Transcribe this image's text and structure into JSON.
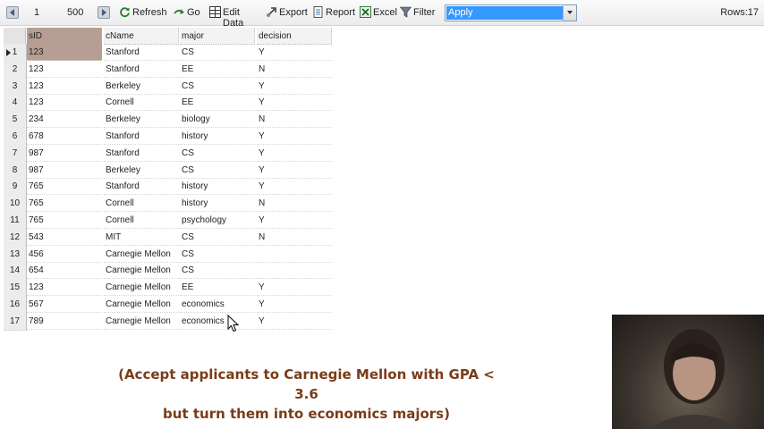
{
  "toolbar": {
    "from": "1",
    "limit": "500",
    "refresh_label": "Refresh",
    "go_label": "Go",
    "edit_label": "Edit Data",
    "export_label": "Export",
    "report_label": "Report",
    "excel_label": "Excel",
    "filter_label": "Filter",
    "table_selected": "Apply",
    "rows_text": "Rows:17"
  },
  "grid": {
    "columns": [
      "sID",
      "cName",
      "major",
      "decision"
    ],
    "rows": [
      [
        "123",
        "Stanford",
        "CS",
        "Y"
      ],
      [
        "123",
        "Stanford",
        "EE",
        "N"
      ],
      [
        "123",
        "Berkeley",
        "CS",
        "Y"
      ],
      [
        "123",
        "Cornell",
        "EE",
        "Y"
      ],
      [
        "234",
        "Berkeley",
        "biology",
        "N"
      ],
      [
        "678",
        "Stanford",
        "history",
        "Y"
      ],
      [
        "987",
        "Stanford",
        "CS",
        "Y"
      ],
      [
        "987",
        "Berkeley",
        "CS",
        "Y"
      ],
      [
        "765",
        "Stanford",
        "history",
        "Y"
      ],
      [
        "765",
        "Cornell",
        "history",
        "N"
      ],
      [
        "765",
        "Cornell",
        "psychology",
        "Y"
      ],
      [
        "543",
        "MIT",
        "CS",
        "N"
      ],
      [
        "456",
        "Carnegie Mellon",
        "CS",
        ""
      ],
      [
        "654",
        "Carnegie Mellon",
        "CS",
        ""
      ],
      [
        "123",
        "Carnegie Mellon",
        "EE",
        "Y"
      ],
      [
        "567",
        "Carnegie Mellon",
        "economics",
        "Y"
      ],
      [
        "789",
        "Carnegie Mellon",
        "economics",
        "Y"
      ]
    ]
  },
  "caption": {
    "line1": "(Accept applicants to Carnegie Mellon with GPA < 3.6",
    "line2": "but turn them into economics majors)"
  }
}
